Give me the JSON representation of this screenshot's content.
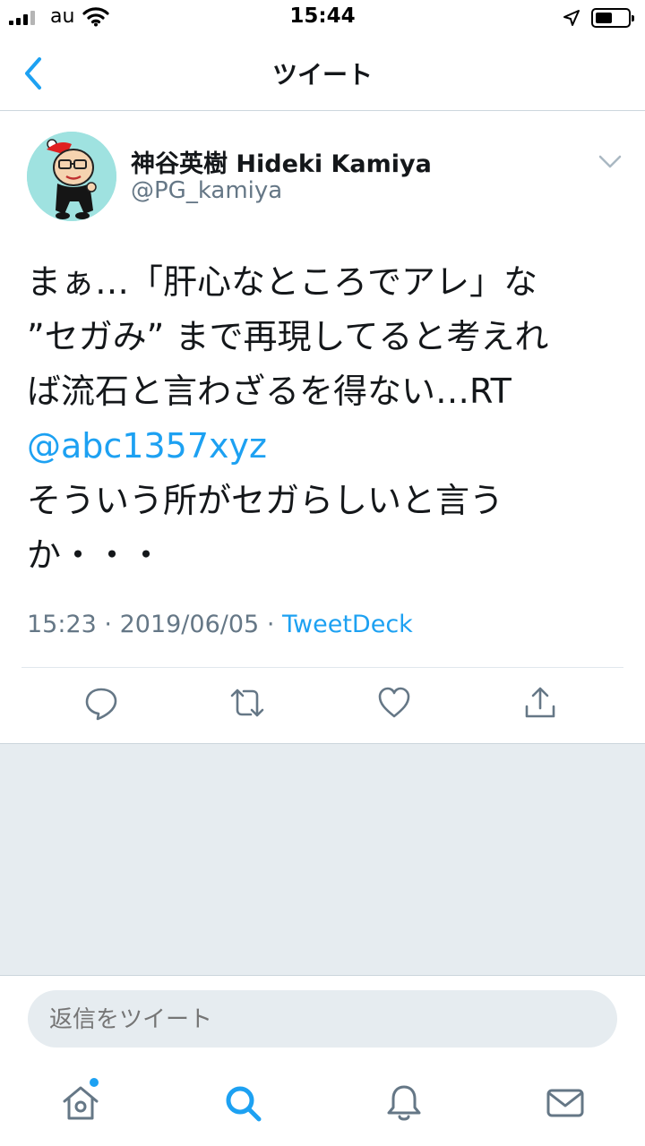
{
  "status_bar": {
    "carrier": "au",
    "time": "15:44"
  },
  "nav": {
    "title": "ツイート"
  },
  "tweet": {
    "author_name": "神谷英樹 Hideki Kamiya",
    "author_handle": "@PG_kamiya",
    "text_lines": [
      "まぁ…「肝心なところでアレ」な",
      "”セガみ” まで再現してると考えれ",
      "ば流石と言わざるを得ない…RT",
      "@abc1357xyz",
      "そういう所がセガらしいと言う",
      "か・・・"
    ],
    "mention": "@abc1357xyz",
    "time": "15:23",
    "separator": "·",
    "date": "2019/06/05",
    "source": "TweetDeck"
  },
  "reply": {
    "placeholder": "返信をツイート"
  },
  "tab_bar": {
    "items": [
      "home-icon",
      "search-icon",
      "notifications-icon",
      "messages-icon"
    ]
  },
  "colors": {
    "accent": "#1da1f2",
    "secondary_text": "#657786",
    "background_grey": "#e6ecf0"
  }
}
